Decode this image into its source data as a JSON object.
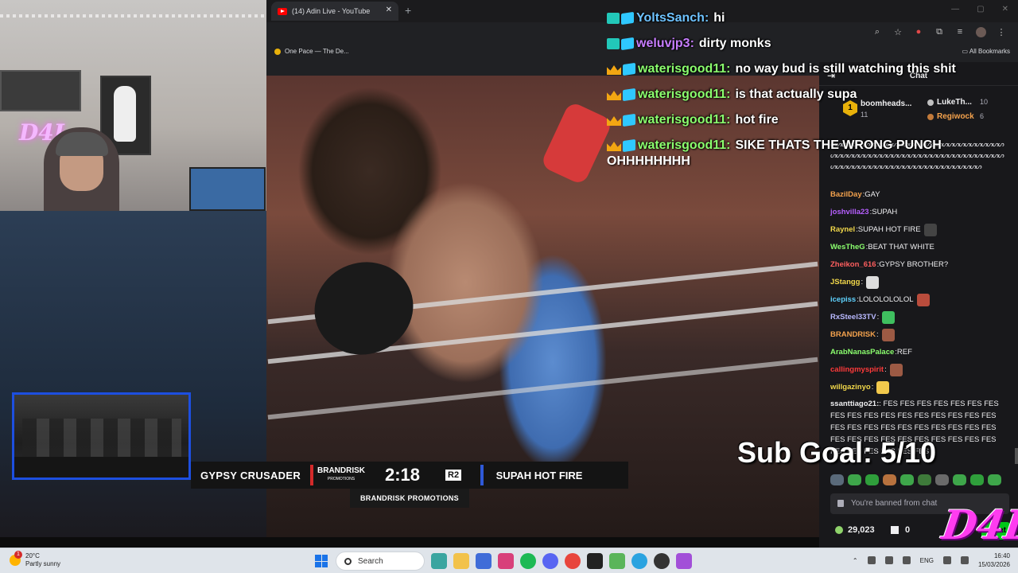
{
  "browser": {
    "tab_title": "(14) Adin Live - YouTube",
    "tab_close": "✕",
    "new_tab": "+",
    "bookmark": "One Pace — The De...",
    "all_bookmarks": "All Bookmarks",
    "window_controls": [
      "—",
      "▢",
      "✕"
    ]
  },
  "video": {
    "fighter_left": "GYPSY CRUSADER",
    "promo_logo": "BRANDRISK",
    "promo_logo_sub": "PROMOTIONS",
    "clock": "2:18",
    "round": "R2",
    "fighter_right": "SUPAH HOT FIRE",
    "sub_banner": "BRANDRISK PROMOTIONS"
  },
  "overlay_chat": [
    {
      "badges": "teal",
      "user": "YoltsSanch:",
      "user_color": "#6ec3ff",
      "msg": "hi"
    },
    {
      "badges": "teal",
      "user": "weluvjp3:",
      "user_color": "#c77dff",
      "msg": "dirty monks"
    },
    {
      "badges": "crown",
      "user": "waterisgood11:",
      "user_color": "#8bff6e",
      "msg": "no way bud is still watching this shit"
    },
    {
      "badges": "crown",
      "user": "waterisgood11:",
      "user_color": "#8bff6e",
      "msg": "is that actually supa"
    },
    {
      "badges": "crown",
      "user": "waterisgood11:",
      "user_color": "#8bff6e",
      "msg": "hot fire"
    },
    {
      "badges": "crown",
      "user": "waterisgood11:",
      "user_color": "#8bff6e",
      "msg": "SIKE THATS THE WRONG PUNCH"
    }
  ],
  "overlay_wrap": "OHHHHHHHH",
  "twitch": {
    "header": "Chat",
    "collapse_icon": "⇥",
    "leaderboard": {
      "first_rank": "1",
      "first_name": "boomheads...",
      "first_count": "11",
      "second_name": "LukeTh...",
      "second_count": "10",
      "third_name": "Regiwock",
      "third_count": "6"
    },
    "squiggle": "ᔕᔕᔕᔕᔕᔕᔕᔕᔕᔕᔕᔕᔕᔕᔕᔕᔕᔕᔕᔕᔕᔕᔕᔕᔕᔕᔕᔕᔕᔕᔕᔕᔕᔕᔕᔕᔕᔕᔕᔕᔕᔕᔕᔕᔕᔕᔕᔕᔕᔕᔕᔕᔕᔕᔕᔕᔕᔕᔕᔕᔕᔕᔕᔕᔕᔕᔕᔕᔕᔕᔕᔕᔕᔕᔕᔕᔕᔕᔕᔕᔕᔕᔕᔕᔕᔕᔕᔕᔕ",
    "messages": [
      {
        "user": "BazilDay",
        "color": "#f4a24d",
        "sep": ": ",
        "msg": "GAY",
        "emote": ""
      },
      {
        "user": "joshvilla23",
        "color": "#b65fff",
        "sep": ": ",
        "msg": "SUPAH",
        "emote": ""
      },
      {
        "user": "Raynel",
        "color": "#f2d84a",
        "sep": ": ",
        "msg": "SUPAH HOT FIRE",
        "emote": "#444"
      },
      {
        "user": "WesTheG",
        "color": "#8bff6e",
        "sep": ": ",
        "msg": "BEAT THAT WHITE",
        "emote": ""
      },
      {
        "user": "Zheikon_616",
        "color": "#ff5f5f",
        "sep": ": ",
        "msg": "GYPSY BROTHER?",
        "emote": ""
      },
      {
        "user": "JStangg",
        "color": "#f2d84a",
        "sep": ": ",
        "msg": "",
        "emote": "#ddd"
      },
      {
        "user": "icepiss",
        "color": "#5fd3ff",
        "sep": ": ",
        "msg": "LOLOLOLOLOL",
        "emote": "#b94c3c"
      },
      {
        "user": "RxSteel33TV",
        "color": "#b9b9ff",
        "sep": ": ",
        "msg": "",
        "emote": "#3fbf5f"
      },
      {
        "user": "BRANDRISK",
        "color": "#f4a24d",
        "sep": ": ",
        "msg": "",
        "emote": "#9c5a44"
      },
      {
        "user": "ArabNanasPalace",
        "color": "#8bff6e",
        "sep": ": ",
        "msg": "REF",
        "emote": ""
      },
      {
        "user": "callingmyspirit",
        "color": "#ff3a3a",
        "sep": ": ",
        "msg": "",
        "emote": "#9c5a44"
      },
      {
        "user": "willgazinyo",
        "color": "#f2d84a",
        "sep": ": ",
        "msg": "",
        "emote": "#f2c94c"
      }
    ],
    "multi_user": "ssanttiago21:",
    "multi_msg": ": FES FES FES FES FES FES FES FES FES FES FES FES FES FES FES FES FES FES FES FES FES FES FES FES FES FES FES FES FES FES FES FES FES FES FES FES FES FES FES FES FES FES FES",
    "input_placeholder": "You're banned from chat",
    "points": "29,023",
    "zero": "0",
    "chat_button": "Chat"
  },
  "sub_goal": "Sub Goal: 5/10",
  "logo_text": "D4L",
  "webcam_neon": "D4L",
  "taskbar": {
    "temp": "20°C",
    "weather": "Partly sunny",
    "weather_badge": "1",
    "search": "Search",
    "lang": "ENG",
    "time": "16:40",
    "date": "15/03/2026"
  },
  "colors": {
    "twitch_bg": "#18181b",
    "chat_button": "#00c819",
    "pip_border": "#1d4fe0",
    "logo_pink": "#ff3cf0"
  }
}
